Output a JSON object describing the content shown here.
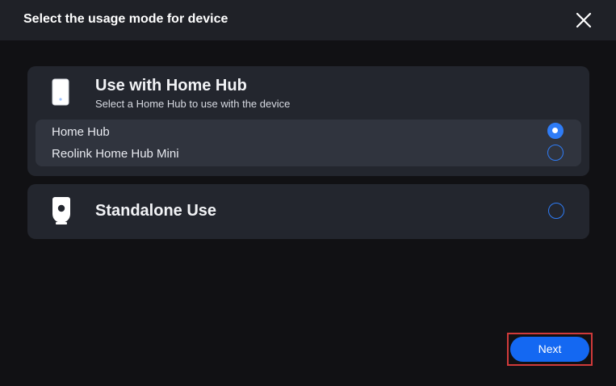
{
  "dialog": {
    "title": "Select the usage mode for device",
    "close_icon": "close-icon"
  },
  "hub_card": {
    "icon": "home-hub-icon",
    "title": "Use with Home Hub",
    "subtitle": "Select a Home Hub to use with the device",
    "options": [
      {
        "label": "Home Hub",
        "selected": true
      },
      {
        "label": "Reolink Home Hub Mini",
        "selected": false
      }
    ]
  },
  "standalone_card": {
    "icon": "camera-icon",
    "title": "Standalone Use",
    "selected": false
  },
  "footer": {
    "next_label": "Next"
  },
  "colors": {
    "accent": "#1468f2",
    "radio": "#2f7cf6",
    "highlight_frame": "#d03a3a",
    "background": "#111114",
    "card": "#23262e",
    "header": "#1f2127"
  }
}
